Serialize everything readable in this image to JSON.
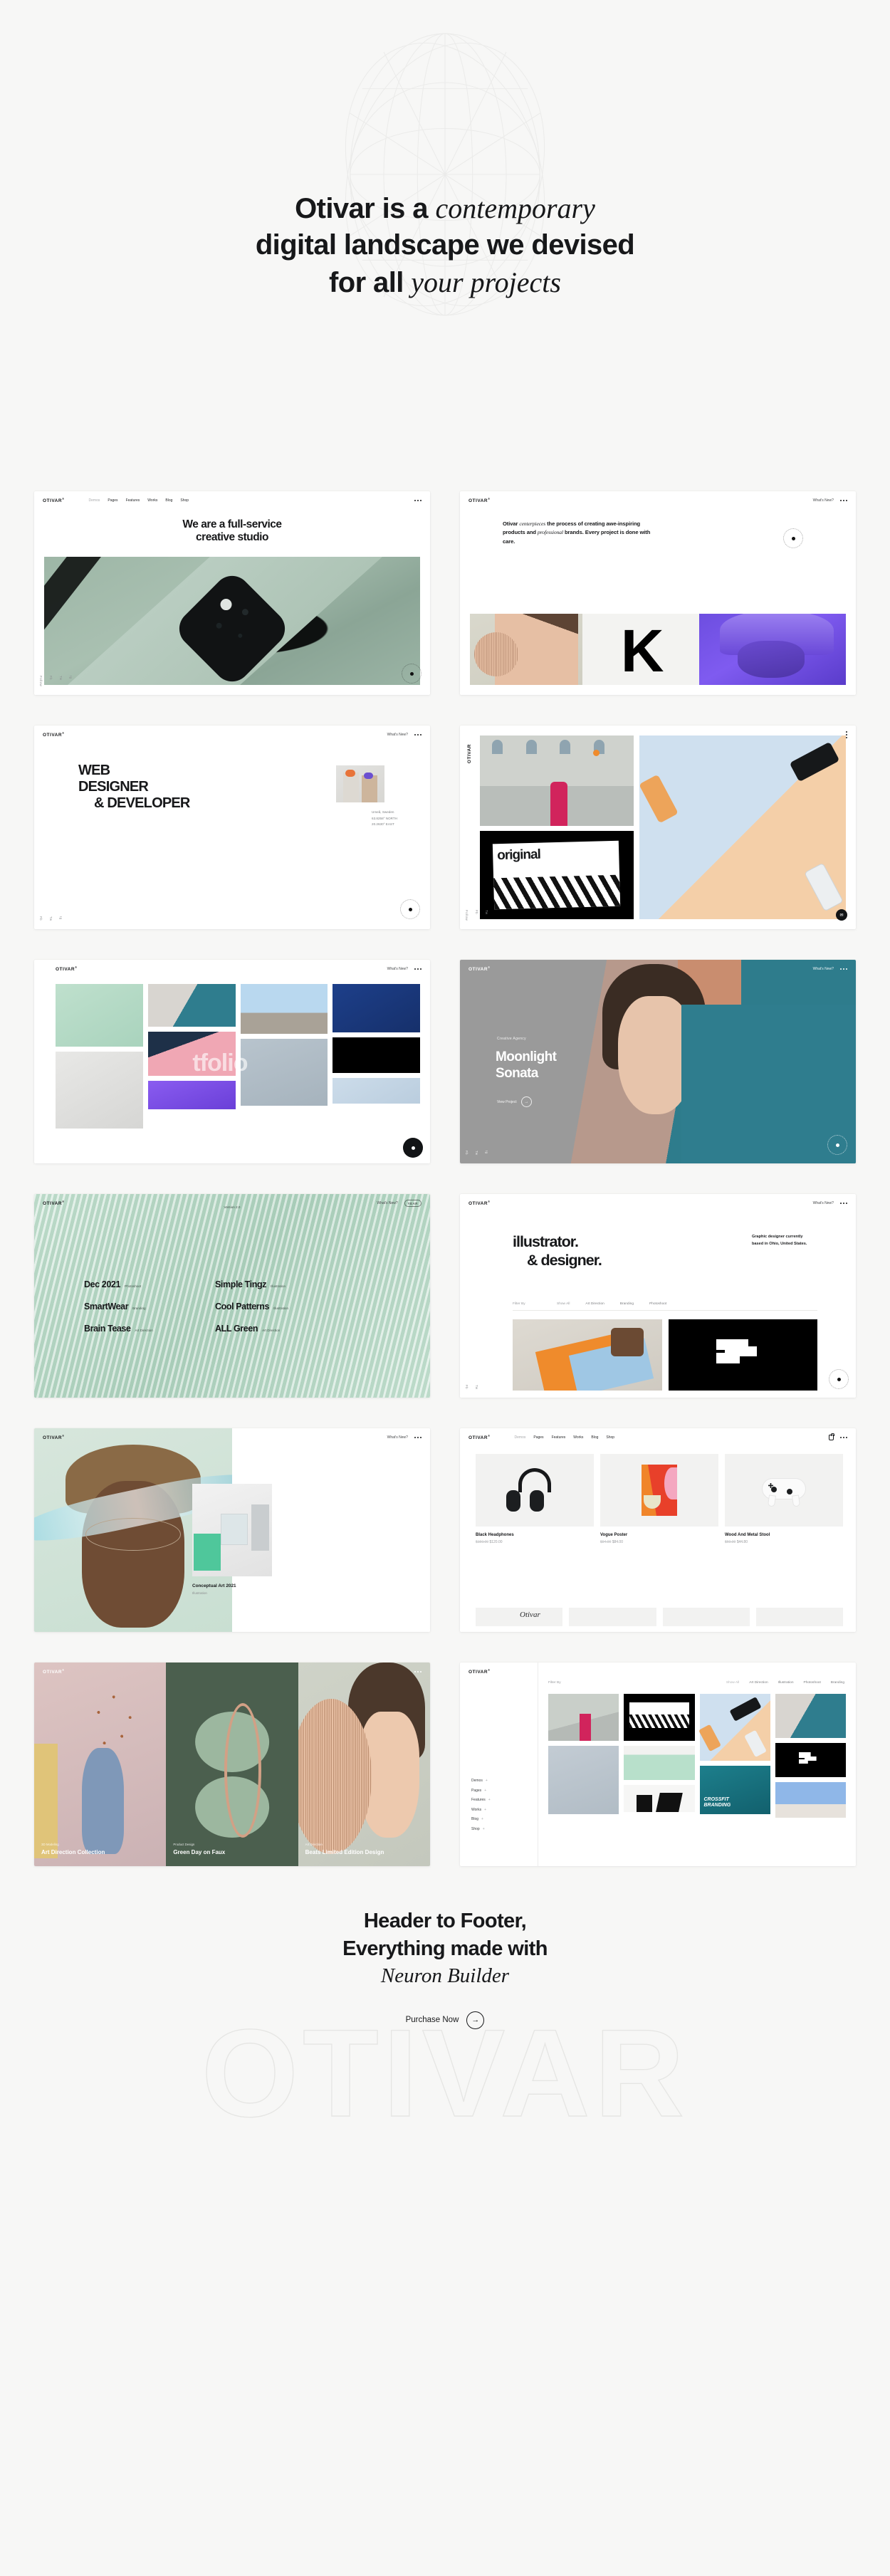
{
  "hero": {
    "line1_bold": "Otivar is a",
    "line1_italic": "contemporary",
    "line2": "digital landscape we devised",
    "line3_bold": "for all",
    "line3_italic": "your projects"
  },
  "brand": {
    "logo": "OTIVAR",
    "logo_sup": "®",
    "whats_new": "What's New?",
    "dots_icon": "more-dots-icon"
  },
  "nav": {
    "items": [
      "Demos",
      "Pages",
      "Features",
      "Works",
      "Blog",
      "Shop"
    ],
    "active": "Demos"
  },
  "side_rail": [
    "Fb",
    "Tw",
    "Ig",
    "Follow"
  ],
  "cards": [
    {
      "id": "full-service-creative-studio",
      "heading_line1": "We are a full-service",
      "heading_line2": "creative studio"
    },
    {
      "id": "centerpieces-intro",
      "p1": "Otivar ",
      "p1_italic": "centerpieces",
      "p2": " the process of creating awe-inspiring products and ",
      "p2_italic": "professional",
      "p3": " brands. Every project is done with care.",
      "letter_mark": "K"
    },
    {
      "id": "web-designer-developer",
      "line1": "WEB",
      "line2": "DESIGNER",
      "line3": "& DEVELOPER",
      "meta": [
        "Umeå, Sweden",
        "63.8258° NORTH",
        "20.2630° EAST"
      ]
    },
    {
      "id": "original-product-showcase",
      "poster_word": "original",
      "mail_icon": "mail-icon"
    },
    {
      "id": "portfolio-masonry-grid",
      "watermark": "tfolio"
    },
    {
      "id": "moonlight-sonata",
      "kicker": "Creative Agency",
      "title_line1": "Moonlight",
      "title_line2": "Sonata",
      "cta": "View Project",
      "cta_icon": "arrow-right-icon"
    },
    {
      "id": "mint-project-list",
      "version": "Version 2.0",
      "year_badge": "YEAR",
      "items": [
        {
          "title": "Dec 2021",
          "tag": "Photoshoot"
        },
        {
          "title": "Simple Tingz",
          "tag": "Illustration"
        },
        {
          "title": "SmartWear",
          "tag": "Branding"
        },
        {
          "title": "Cool Patterns",
          "tag": "Illustration"
        },
        {
          "title": "Brain Tease",
          "tag": "Art Direction"
        },
        {
          "title": "ALL Green",
          "tag": "Art Direction"
        }
      ]
    },
    {
      "id": "illustrator-designer",
      "line1": "illustrator.",
      "line2": "& designer.",
      "note": "Graphic designer currently based in Ohio, United States.",
      "filter_label": "Filter By",
      "filters": [
        "Show All",
        "Art Direction",
        "Branding",
        "Photoshoot"
      ]
    },
    {
      "id": "conceptual-art-portrait",
      "caption_title": "Conceptual Art 2021",
      "caption_tag": "Illustration"
    },
    {
      "id": "shop-products",
      "cart_icon": "cart-bag-icon",
      "products": [
        {
          "name": "Black Headphones",
          "price": "$120.00",
          "old_price": "$150.00"
        },
        {
          "name": "Vogue Poster",
          "price": "$84.00",
          "old_price": "$94.00"
        },
        {
          "name": "Wood And Metal Stool",
          "price": "$44.80",
          "old_price": "$60.00"
        }
      ],
      "signature": "Otivar"
    },
    {
      "id": "three-panel-showcase",
      "panels": [
        {
          "tag": "3D Modeling",
          "title": "Art Direction Collection"
        },
        {
          "tag": "Product Design",
          "title": "Green Day on Faux"
        },
        {
          "tag": "Art Direction",
          "title": "Beats Limited Edition Design"
        }
      ]
    },
    {
      "id": "works-sidebar-grid",
      "filter_label": "Filter By",
      "filters": [
        "Show All",
        "Art Direction",
        "Illustration",
        "Photoshoot",
        "Branding"
      ],
      "sidebar_items": [
        "Demos",
        "Pages",
        "Features",
        "Works",
        "Blog",
        "Shop"
      ],
      "crossfit_line1": "CROSSFIT",
      "crossfit_line2": "BRANDING"
    }
  ],
  "footer": {
    "line1": "Header to Footer,",
    "line2": "Everything made with",
    "line3_italic": "Neuron Builder",
    "cta_label": "Purchase Now",
    "cta_icon": "arrow-right-icon",
    "outline_word": "OTIVAR"
  },
  "colors": {
    "page_bg": "#f7f7f6",
    "card_bg": "#ffffff",
    "ink": "#17181a",
    "mint": "#a8cdb9",
    "purple": "#7f5bf0",
    "teal": "#2f7d8e",
    "orange": "#f0852a",
    "pink": "#d1245c"
  }
}
